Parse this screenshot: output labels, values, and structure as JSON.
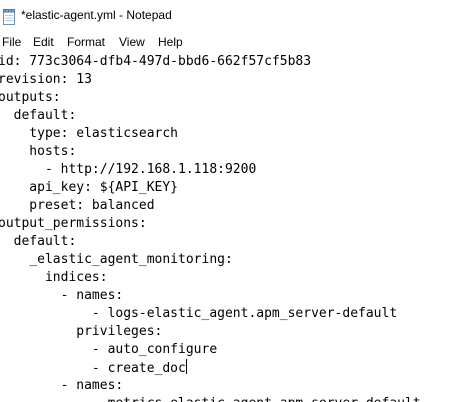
{
  "window": {
    "title": "*elastic-agent.yml - Notepad",
    "icon": "notepad-icon"
  },
  "menu": {
    "file": "File",
    "edit": "Edit",
    "format": "Format",
    "view": "View",
    "help": "Help"
  },
  "editor": {
    "lines": [
      "id: 773c3064-dfb4-497d-bbd6-662f57cf5b83",
      "revision: 13",
      "outputs:",
      "  default:",
      "    type: elasticsearch",
      "    hosts:",
      "      - http://192.168.1.118:9200",
      "    api_key: ${API_KEY}",
      "    preset: balanced",
      "output_permissions:",
      "  default:",
      "    _elastic_agent_monitoring:",
      "      indices:",
      "        - names:",
      "            - logs-elastic_agent.apm_server-default",
      "          privileges:",
      "            - auto_configure",
      "            - create_doc",
      "        - names:",
      "            - metrics-elastic_agent.apm_server-default"
    ],
    "caret_line": 17
  }
}
